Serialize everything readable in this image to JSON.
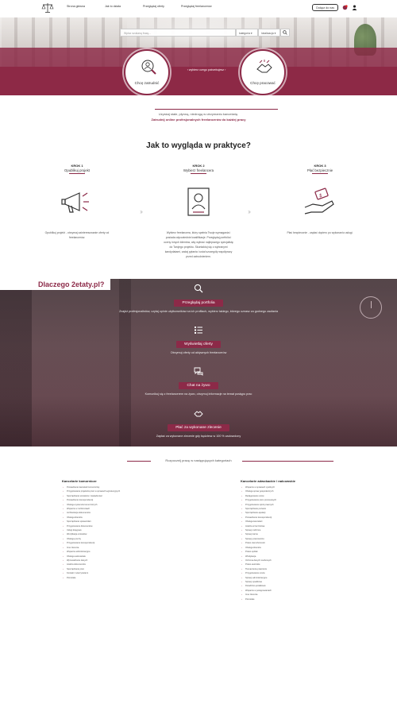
{
  "nav": {
    "links": [
      "Strona główna",
      "Jak to działa",
      "Przeglądaj oferty",
      "Przeglądaj freelancerów"
    ],
    "join_label": "Dołącz do nas"
  },
  "hero": {
    "search_placeholder": "Wpisz szukaną frazę...",
    "select_category": "kategoria",
    "select_location": "lokalizacja",
    "left_label": "Chcę zatrudnić",
    "right_label": "Chcę pracować",
    "choose_text": "wybierz czego potrzebujesz"
  },
  "intro": {
    "line1": "Uzyskaj stałe, płynną, niedrogą w utrzymaniu kancelarię.",
    "line2": "Zatrudnij online profesjonalnych freelancerów do każdej pracy"
  },
  "how": {
    "title": "Jak to wygląda w praktyce?",
    "steps": [
      {
        "k": "KROK 1",
        "n": "Opublikuj projekt",
        "desc": "Opublikuj projekt - otrzymaj zainteresowanie oferty od freelancerów."
      },
      {
        "k": "KROK 2",
        "n": "Wybierz freelancera",
        "desc": "Wybierz freelancera, który spełnia Twoje wymagania i posiada odpowiednie kwalifikacje. Przeglądaj portfolia i oceny innych klientów, aby wybrać najlepszego specjalistę do Twojego projektu. Skontaktuj się z wybranymi kandydatami, zadaj pytania i ustal szczegóły współpracy przed zatrudnieniem."
      },
      {
        "k": "KROK 3",
        "n": "Płać bezpiecznie",
        "desc": "Płać bezpiecznie - zapłać dopiero po wykonaniu usługi."
      }
    ]
  },
  "why": {
    "title": "Dlaczego 2etaty.pl?",
    "items": [
      {
        "badge": "Przeglądaj portfolia",
        "text": "Znajdź profesjonalistów, czytaj opinie użytkowników na ich profilach, wybierz takiego, którego uznasz za godnego zaufania"
      },
      {
        "badge": "Wyświetlaj oferty",
        "text": "Otrzymuj oferty od aktywnych freelancerów"
      },
      {
        "badge": "Chat na żywo",
        "text": "Komunikuj się z freelancerem na żywo, otrzymuj informacje na temat postępu prac"
      },
      {
        "badge": "Płać za wykonane zlecenie",
        "text": "Zapłać za wykonane zlecenie gdy będziesz w 100 % zadowolony"
      }
    ]
  },
  "categories": {
    "heading": "Rozpocznij pracę w następujących kategoriach",
    "left": {
      "title": "Kancelarie komornicze",
      "items": [
        "Prowadzenie kancelarii komorniczej",
        "Przygotowanie projektów pism w sprawach egzekucyjnych",
        "Sporządzanie wniosków i zawiadomień",
        "Prowadzenie korespondencji",
        "Obsługa systemów komorniczych",
        "Wsparcie w rozliczeniach",
        "Archiwizacja dokumentów",
        "Obsługa klientów",
        "Sporządzanie sprawozdań",
        "Przygotowanie dokumentów",
        "Usługi księgowe",
        "Weryfikacja wniosków",
        "Obsługa poczty",
        "Przygotowanie korespondencji",
        "Inne zlecenia",
        "Wsparcie administracyjne",
        "Obsługa sekretariatu",
        "Wprowadzanie danych",
        "Analiza dokumentów",
        "Sporządzanie pism",
        "Kontakt z wierzycielami",
        "Pozostałe"
      ]
    },
    "right": {
      "title": "Kancelarie adwokackie / radcowskie",
      "items": [
        "Wsparcie w sprawach cywilnych",
        "Obsługa spraw gospodarczych",
        "Redagowanie umów",
        "Przygotowanie pism procesowych",
        "Przygotowanie opinii prawnych",
        "Sporządzanie pozwów",
        "Sporządzanie apelacji",
        "Prowadzenie korespondencji",
        "Obsługa kancelarii",
        "Analiza orzecznictwa",
        "Sprawy rodzinne",
        "Sprawy karne",
        "Sprawy pracownicze",
        "Prawo nieruchomości",
        "Obsługa klientów",
        "Prawo spółek",
        "Windykacja",
        "Ochrona danych osobowych",
        "Prawo autorskie",
        "Tłumaczenia prawnicze",
        "Przygotowanie umów",
        "Sprawy administracyjne",
        "Sprawy spadkowe",
        "Doradztwo podatkowe",
        "Wsparcie w postępowaniach",
        "Inne zlecenia",
        "Pozostałe"
      ]
    }
  },
  "colors": {
    "accent": "#8c2a48"
  }
}
